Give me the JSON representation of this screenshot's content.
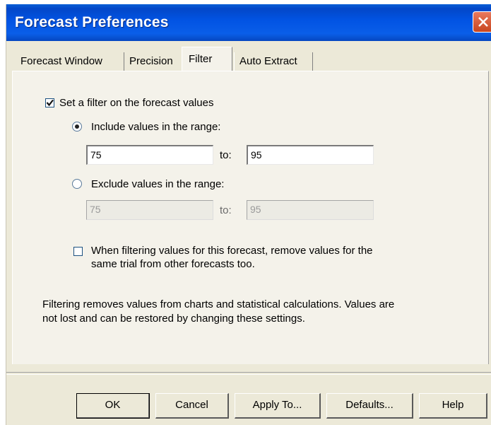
{
  "window": {
    "title": "Forecast Preferences"
  },
  "tabs": [
    {
      "label": "Forecast Window"
    },
    {
      "label": "Precision"
    },
    {
      "label": "Filter",
      "active": true
    },
    {
      "label": "Auto Extract"
    }
  ],
  "filter": {
    "set_filter_label": "Set a filter on the forecast values",
    "set_filter_checked": true,
    "include_label": "Include values in the range:",
    "include_selected": true,
    "include_from": "75",
    "include_to": "95",
    "to_label": "to:",
    "exclude_label": "Exclude values in the range:",
    "exclude_selected": false,
    "exclude_from": "75",
    "exclude_to": "95",
    "remove_trial_line1": "When filtering values for this forecast, remove values for the",
    "remove_trial_line2": "same trial from other forecasts too.",
    "remove_trial_checked": false,
    "info_line1": "Filtering removes values from charts and statistical calculations.  Values are",
    "info_line2": "not lost and can be restored by changing these settings."
  },
  "buttons": {
    "ok": "OK",
    "cancel": "Cancel",
    "apply_to": "Apply To...",
    "defaults": "Defaults...",
    "help": "Help"
  }
}
